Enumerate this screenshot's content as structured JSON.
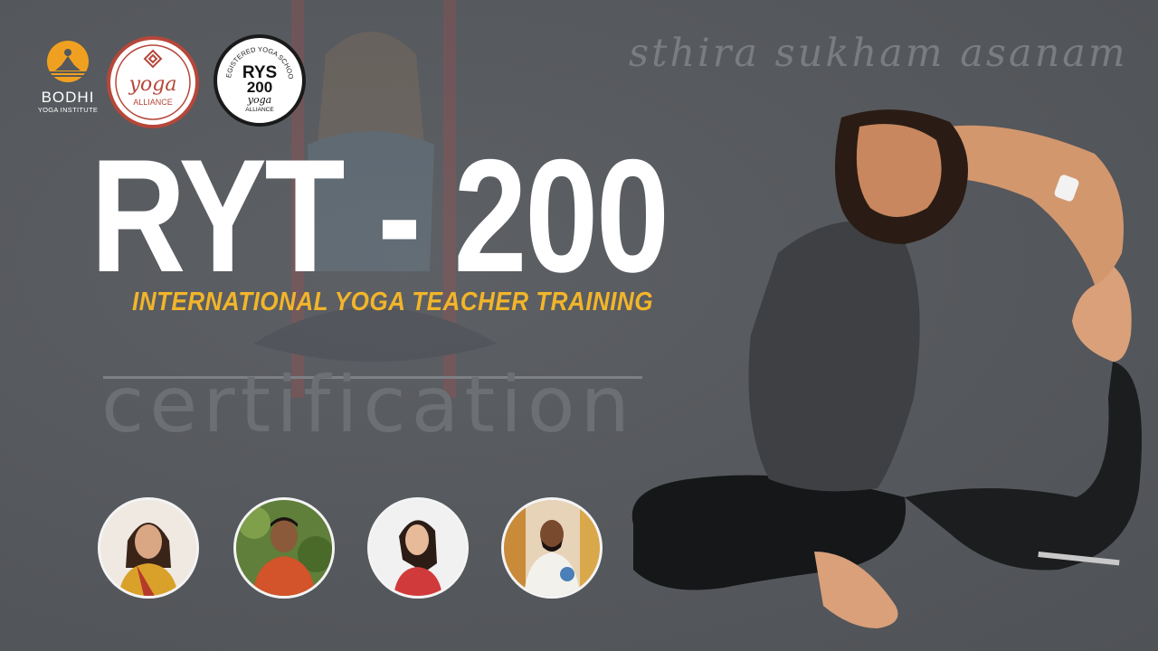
{
  "logos": {
    "bodhi_name": "BODHI",
    "bodhi_sub": "YOGA INSTITUTE",
    "ya_word": "yoga",
    "ya_alliance": "ALLIANCE",
    "rys_arc": "REGISTERED YOGA SCHOOL",
    "rys_code": "RYS",
    "rys_num": "200",
    "rys_word": "yoga",
    "rys_alliance": "ALLIANCE"
  },
  "banner": {
    "tagline": "sthira sukham asanam",
    "title": "RYT - 200",
    "subtitle": "INTERNATIONAL YOGA TEACHER TRAINING",
    "certification": "certification"
  },
  "instructors": [
    {
      "icon": "instructor-saree-woman"
    },
    {
      "icon": "instructor-man-orange-shirt"
    },
    {
      "icon": "instructor-woman-red-top"
    },
    {
      "icon": "instructor-man-white-shirt"
    }
  ],
  "colors": {
    "background": "#55585c",
    "title": "#ffffff",
    "subtitle": "#f2b52a",
    "watermark": "#7a7d80",
    "brand_orange": "#f0a020",
    "yoga_alliance_red": "#b5473a"
  }
}
